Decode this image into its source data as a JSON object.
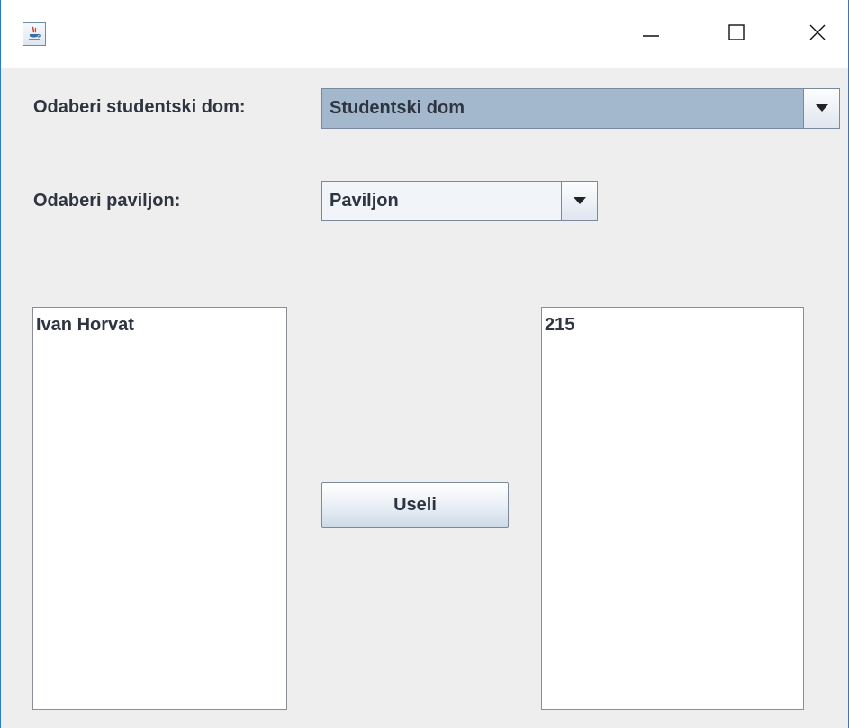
{
  "window": {
    "app_icon": "java-cup-icon",
    "controls": [
      "minimize-icon",
      "maximize-icon",
      "close-icon"
    ]
  },
  "form": {
    "dorm_label": "Odaberi studentski dom:",
    "dorm_selected": "Studentski dom",
    "pavilion_label": "Odaberi paviljon:",
    "pavilion_selected": "Paviljon"
  },
  "students_list": {
    "items": [
      "Ivan Horvat"
    ]
  },
  "rooms_list": {
    "items": [
      "215"
    ]
  },
  "actions": {
    "move_in_label": "Useli"
  },
  "colors": {
    "accent_border": "#2b79d0",
    "combo_selected_bg": "#a3b8cc",
    "panel_bg": "#eeeeee"
  }
}
